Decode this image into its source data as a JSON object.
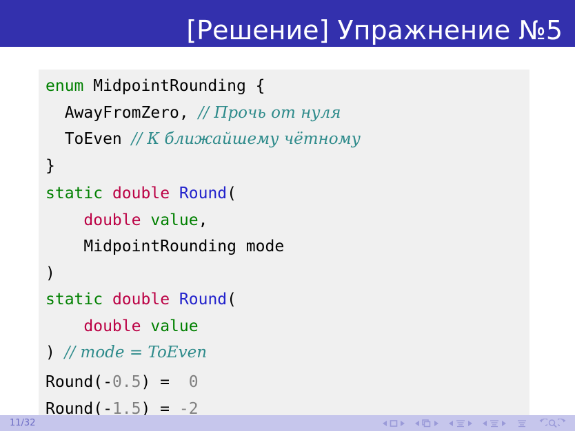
{
  "slide": {
    "title": "[Решение] Упражнение №5",
    "page_number": "11/32",
    "accent_color": "#3330ad",
    "footer_color": "#c6c6ec",
    "code_bg": "#f0f0f0"
  },
  "code_blocks": [
    {
      "id": "enum-block",
      "lines": [
        {
          "tokens": [
            {
              "t": "enum",
              "c": "keyword"
            },
            {
              "t": " MidpointRounding {",
              "c": "plain"
            }
          ]
        },
        {
          "tokens": [
            {
              "t": "  AwayFromZero, ",
              "c": "plain"
            },
            {
              "t": "// Прочь от нуля",
              "c": "comment"
            }
          ]
        },
        {
          "tokens": [
            {
              "t": "  ToEven ",
              "c": "plain"
            },
            {
              "t": "// К ближайшему чётному",
              "c": "comment"
            }
          ]
        },
        {
          "tokens": [
            {
              "t": "}",
              "c": "plain"
            }
          ]
        }
      ]
    },
    {
      "id": "signature-block",
      "lines": [
        {
          "tokens": [
            {
              "t": "static",
              "c": "keyword"
            },
            {
              "t": " ",
              "c": "plain"
            },
            {
              "t": "double",
              "c": "type"
            },
            {
              "t": " ",
              "c": "plain"
            },
            {
              "t": "Round",
              "c": "function"
            },
            {
              "t": "(",
              "c": "plain"
            }
          ]
        },
        {
          "tokens": [
            {
              "t": "    ",
              "c": "plain"
            },
            {
              "t": "double",
              "c": "type"
            },
            {
              "t": " ",
              "c": "plain"
            },
            {
              "t": "value",
              "c": "keyword"
            },
            {
              "t": ",",
              "c": "plain"
            }
          ]
        },
        {
          "tokens": [
            {
              "t": "    MidpointRounding mode",
              "c": "plain"
            }
          ]
        },
        {
          "tokens": [
            {
              "t": ")",
              "c": "plain"
            }
          ]
        },
        {
          "tokens": [
            {
              "t": "static",
              "c": "keyword"
            },
            {
              "t": " ",
              "c": "plain"
            },
            {
              "t": "double",
              "c": "type"
            },
            {
              "t": " ",
              "c": "plain"
            },
            {
              "t": "Round",
              "c": "function"
            },
            {
              "t": "(",
              "c": "plain"
            }
          ]
        },
        {
          "tokens": [
            {
              "t": "    ",
              "c": "plain"
            },
            {
              "t": "double",
              "c": "type"
            },
            {
              "t": " ",
              "c": "plain"
            },
            {
              "t": "value",
              "c": "keyword"
            }
          ]
        },
        {
          "tokens": [
            {
              "t": ") ",
              "c": "plain"
            },
            {
              "t": "// mode = ToEven",
              "c": "comment"
            }
          ]
        }
      ]
    },
    {
      "id": "output-block",
      "lines": [
        {
          "tokens": [
            {
              "t": "Round(-",
              "c": "plain"
            },
            {
              "t": "0.5",
              "c": "number"
            },
            {
              "t": ") =  ",
              "c": "plain"
            },
            {
              "t": "0",
              "c": "number"
            }
          ]
        },
        {
          "tokens": [
            {
              "t": "Round(-",
              "c": "plain"
            },
            {
              "t": "1.5",
              "c": "number"
            },
            {
              "t": ") = ",
              "c": "plain"
            },
            {
              "t": "-2",
              "c": "number"
            }
          ]
        }
      ]
    }
  ],
  "nav": {
    "symbols": [
      "prev-slide-arrow",
      "slide-icon",
      "next-slide-arrow",
      "prev-frame-arrow",
      "frame-icon",
      "next-frame-arrow",
      "prev-subsection-arrow",
      "subsection-icon",
      "next-subsection-arrow",
      "prev-section-arrow",
      "section-icon",
      "next-section-arrow",
      "presentation-icon",
      "back-icon",
      "search-icon",
      "forward-icon"
    ]
  }
}
